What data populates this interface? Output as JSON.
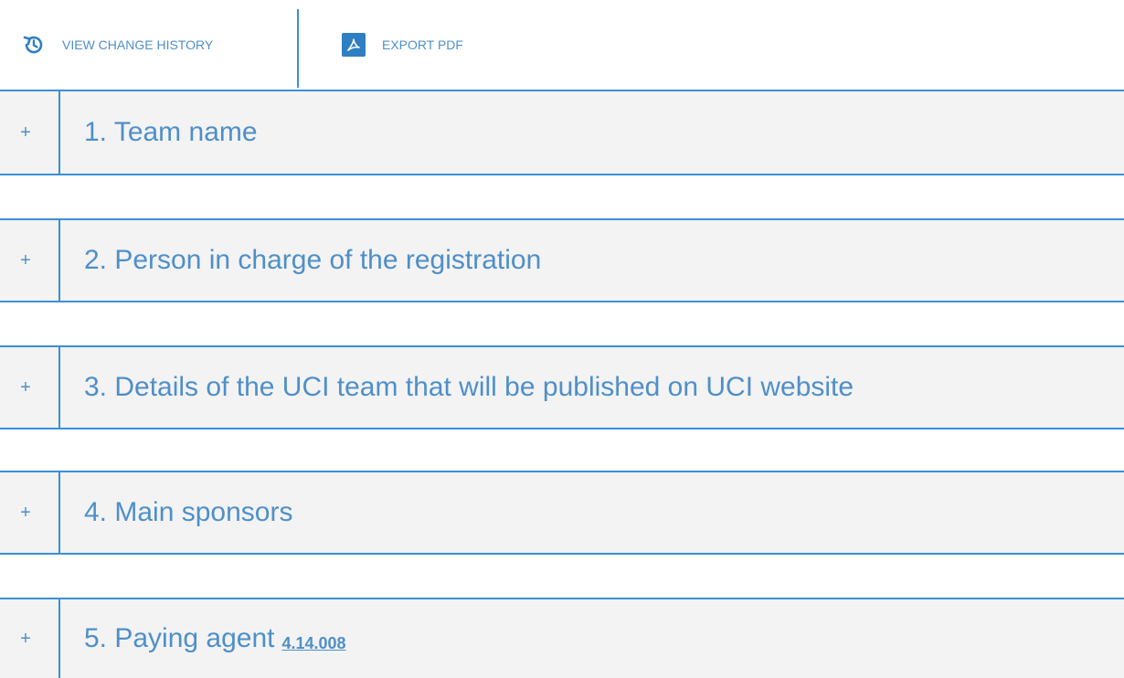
{
  "toolbar": {
    "history_label": "VIEW CHANGE HISTORY",
    "history_icon": "history-icon",
    "export_label": "EXPORT PDF",
    "export_icon": "pdf-icon"
  },
  "sections": [
    {
      "toggle": "+",
      "title": "1. Team name"
    },
    {
      "toggle": "+",
      "title": "2. Person in charge of the registration"
    },
    {
      "toggle": "+",
      "title": "3. Details of the UCI team that will be published on UCI website"
    },
    {
      "toggle": "+",
      "title": "4. Main sponsors"
    },
    {
      "toggle": "+",
      "title": "5. Paying agent",
      "ref": "4.14.008"
    }
  ],
  "colors": {
    "accent": "#3a8fd8",
    "text": "#4f8fc8",
    "section_bg": "#f3f3f4"
  }
}
